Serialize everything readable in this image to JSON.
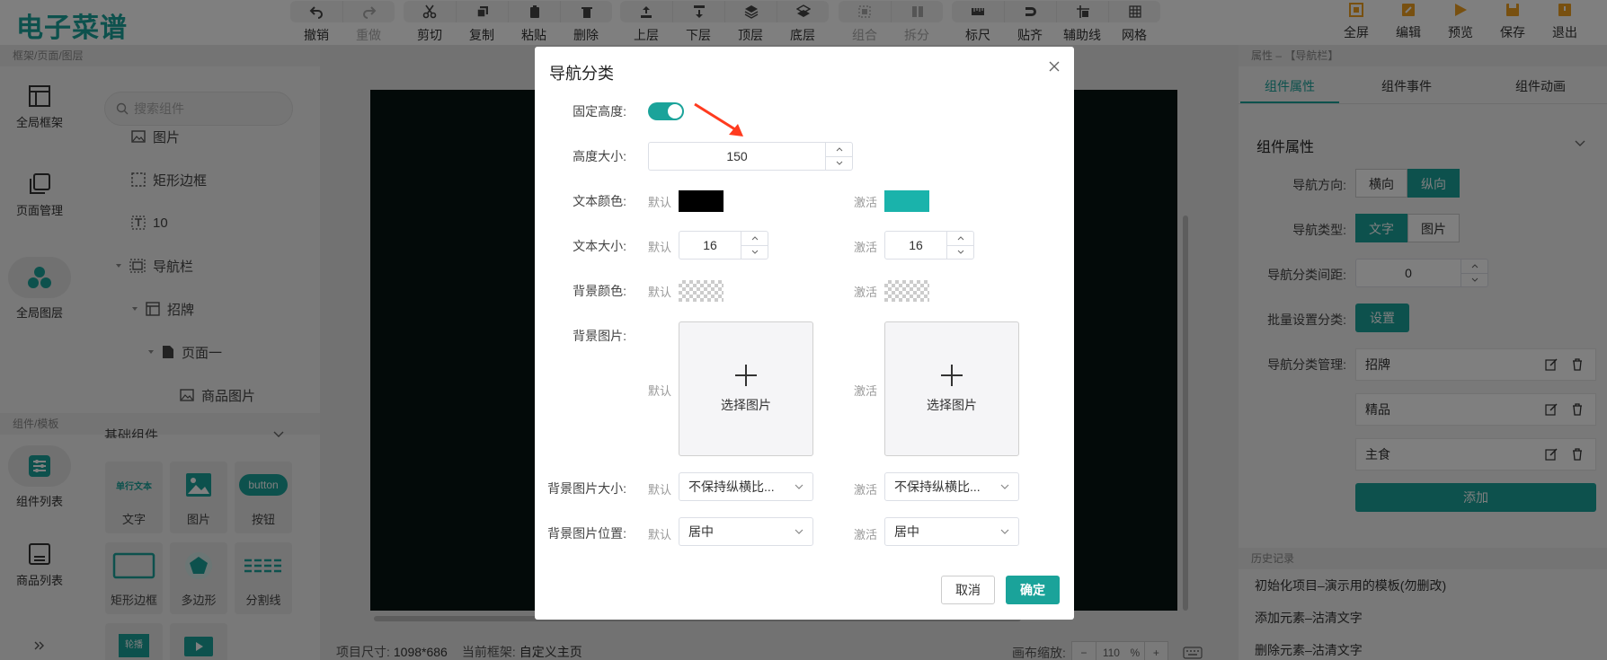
{
  "app": {
    "logo": "电子菜谱"
  },
  "toolbar": {
    "groups": [
      [
        {
          "label": "撤销",
          "enabled": true
        },
        {
          "label": "重做",
          "enabled": false
        }
      ],
      [
        {
          "label": "剪切",
          "enabled": true
        },
        {
          "label": "复制",
          "enabled": true
        },
        {
          "label": "粘贴",
          "enabled": true
        },
        {
          "label": "删除",
          "enabled": true
        }
      ],
      [
        {
          "label": "上层",
          "enabled": true
        },
        {
          "label": "下层",
          "enabled": true
        },
        {
          "label": "顶层",
          "enabled": true
        },
        {
          "label": "底层",
          "enabled": true
        }
      ],
      [
        {
          "label": "组合",
          "enabled": false
        },
        {
          "label": "拆分",
          "enabled": false
        }
      ],
      [
        {
          "label": "标尺",
          "enabled": true
        },
        {
          "label": "贴齐",
          "enabled": true
        },
        {
          "label": "辅助线",
          "enabled": true
        },
        {
          "label": "网格",
          "enabled": true
        }
      ]
    ],
    "right": [
      {
        "label": "全屏"
      },
      {
        "label": "编辑"
      },
      {
        "label": "预览"
      },
      {
        "label": "保存"
      },
      {
        "label": "退出"
      }
    ],
    "icon_color": "#444444",
    "right_icon_color": "#f0a020"
  },
  "left": {
    "section1_title": "框架/页面/图层",
    "nav": [
      {
        "label": "全局框架",
        "icon": "frame-icon"
      },
      {
        "label": "页面管理",
        "icon": "pages-icon"
      },
      {
        "label": "全局图层",
        "icon": "layers-icon"
      }
    ],
    "search_placeholder": "搜索组件",
    "tree": [
      {
        "label": "图片"
      },
      {
        "label": "矩形边框"
      },
      {
        "label": "10"
      },
      {
        "label": "导航栏"
      },
      {
        "label": "招牌"
      },
      {
        "label": "页面一"
      },
      {
        "label": "商品图片"
      }
    ],
    "section2_title": "组件/模板",
    "nav2": [
      {
        "label": "组件列表",
        "icon": "component-list-icon"
      },
      {
        "label": "商品列表",
        "icon": "product-list-icon"
      }
    ],
    "basic_group": "基础组件",
    "components": [
      {
        "label": "文字",
        "thumb": "单行文本"
      },
      {
        "label": "图片"
      },
      {
        "label": "按钮",
        "thumb": "button"
      },
      {
        "label": "矩形边框"
      },
      {
        "label": "多边形"
      },
      {
        "label": "分割线"
      },
      {
        "label": "",
        "thumb": "轮播"
      },
      {
        "label": ""
      }
    ]
  },
  "status": {
    "size_label": "项目尺寸:",
    "size_value": "1098*686",
    "frame_label": "当前框架:",
    "frame_value": "自定义主页",
    "zoom_label": "画布缩放:",
    "zoom_minus": "−",
    "zoom_value": "110",
    "zoom_unit": "%",
    "zoom_plus": "+"
  },
  "right": {
    "header": "属性 – 【导航栏】",
    "tabs": [
      {
        "label": "组件属性",
        "active": true
      },
      {
        "label": "组件事件",
        "active": false
      },
      {
        "label": "组件动画",
        "active": false
      }
    ],
    "section_title": "组件属性",
    "direction": {
      "label": "导航方向:",
      "options": [
        "横向",
        "纵向"
      ],
      "active": 1
    },
    "nav_type": {
      "label": "导航类型:",
      "options": [
        "文字",
        "图片"
      ],
      "active": 0
    },
    "spacing": {
      "label": "导航分类间距:",
      "value": "0"
    },
    "batch": {
      "label": "批量设置分类:",
      "button": "设置"
    },
    "manage": {
      "label": "导航分类管理:",
      "items": [
        "招牌",
        "精品",
        "主食"
      ],
      "add_button": "添加"
    },
    "history_title": "历史记录",
    "history": [
      "初始化项目–演示用的模板(勿删改)",
      "添加元素–沽清文字",
      "删除元素–沽清文字"
    ]
  },
  "dialog": {
    "title": "导航分类",
    "fixed_height": {
      "label": "固定高度:",
      "on": true
    },
    "height_size": {
      "label": "高度大小:",
      "value": "150"
    },
    "text_color": {
      "label": "文本颜色:",
      "default_label": "默认",
      "default_color": "#000000",
      "active_label": "激活",
      "active_color": "#1ab3ab"
    },
    "text_size": {
      "label": "文本大小:",
      "default_label": "默认",
      "default_value": "16",
      "active_label": "激活",
      "active_value": "16"
    },
    "bg_color": {
      "label": "背景颜色:",
      "default_label": "默认",
      "active_label": "激活"
    },
    "bg_image": {
      "label": "背景图片:",
      "default_label": "默认",
      "active_label": "激活",
      "upload_text": "选择图片"
    },
    "bg_image_size": {
      "label": "背景图片大小:",
      "default_label": "默认",
      "default_value": "不保持纵横比...",
      "active_label": "激活",
      "active_value": "不保持纵横比..."
    },
    "bg_image_pos": {
      "label": "背景图片位置:",
      "default_label": "默认",
      "default_value": "居中",
      "active_label": "激活",
      "active_value": "居中"
    },
    "cancel": "取消",
    "confirm": "确定",
    "accent": "#1aa39a"
  }
}
